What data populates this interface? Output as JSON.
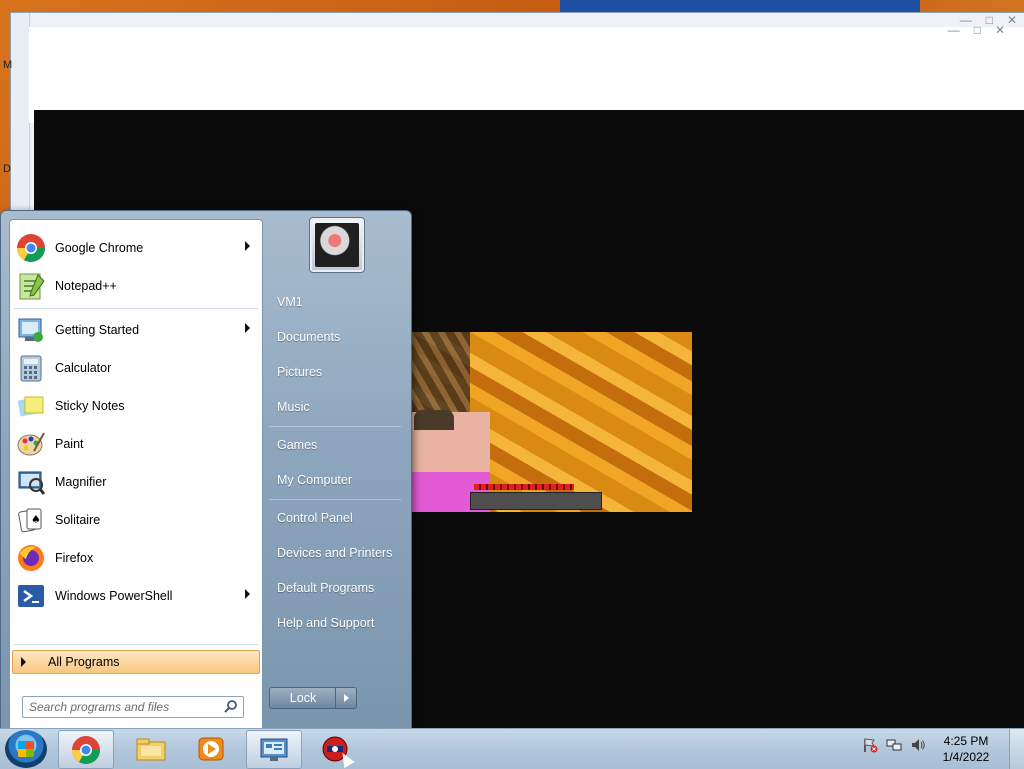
{
  "desktop": {
    "side_letters": [
      "M",
      "D"
    ]
  },
  "start_menu": {
    "pinned": [
      {
        "label": "Google Chrome",
        "icon": "chrome-icon",
        "has_submenu": true
      },
      {
        "label": "Notepad++",
        "icon": "notepadpp-icon",
        "has_submenu": false
      }
    ],
    "recent": [
      {
        "label": "Getting Started",
        "icon": "getting-started-icon",
        "has_submenu": true
      },
      {
        "label": "Calculator",
        "icon": "calculator-icon",
        "has_submenu": false
      },
      {
        "label": "Sticky Notes",
        "icon": "sticky-notes-icon",
        "has_submenu": false
      },
      {
        "label": "Paint",
        "icon": "paint-icon",
        "has_submenu": false
      },
      {
        "label": "Magnifier",
        "icon": "magnifier-icon",
        "has_submenu": false
      },
      {
        "label": "Solitaire",
        "icon": "solitaire-icon",
        "has_submenu": false
      },
      {
        "label": "Firefox",
        "icon": "firefox-icon",
        "has_submenu": false
      },
      {
        "label": "Windows PowerShell",
        "icon": "powershell-icon",
        "has_submenu": true
      }
    ],
    "all_programs_label": "All Programs",
    "search_placeholder": "Search programs and files",
    "right_items": [
      {
        "label": "VM1"
      },
      {
        "label": "Documents"
      },
      {
        "label": "Pictures"
      },
      {
        "label": "Music"
      },
      {
        "label": "Games"
      },
      {
        "label": "My Computer"
      },
      {
        "label": "Control Panel"
      },
      {
        "label": "Devices and Printers"
      },
      {
        "label": "Default Programs"
      },
      {
        "label": "Help and Support"
      }
    ],
    "lock_label": "Lock"
  },
  "taskbar": {
    "apps": [
      "chrome-icon",
      "explorer-icon",
      "media-player-icon",
      "control-panel-icon",
      "app-icon"
    ],
    "clock_time": "4:25 PM",
    "clock_date": "1/4/2022"
  },
  "colors": {
    "accent": "#f9c680",
    "taskbar": "#b2c7db",
    "menu_right": "#8ea6bd"
  }
}
